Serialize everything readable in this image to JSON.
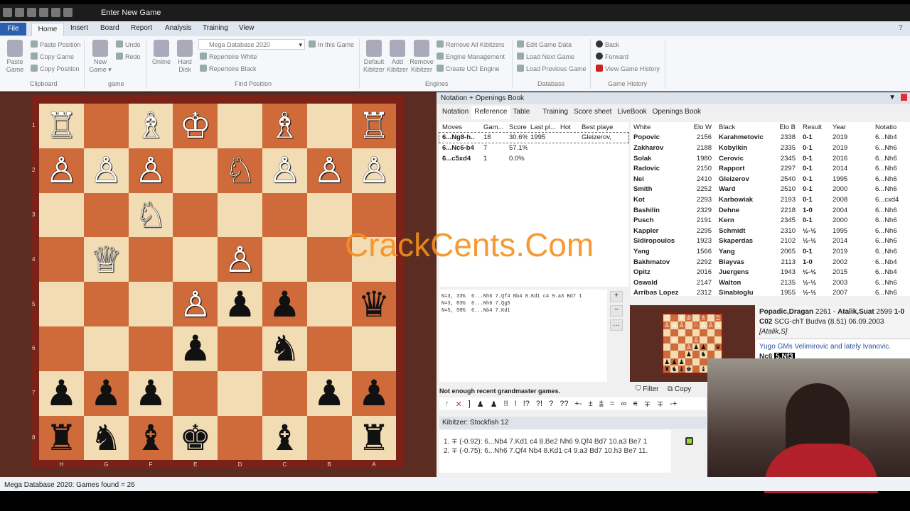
{
  "window": {
    "title": "Enter New Game"
  },
  "menu": {
    "file": "File",
    "tabs": [
      "Home",
      "Insert",
      "Board",
      "Report",
      "Analysis",
      "Training",
      "View"
    ]
  },
  "ribbon": {
    "clipboard": {
      "paste_game": "Paste Game",
      "paste_position": "Paste Position",
      "copy_game": "Copy Game",
      "copy_position": "Copy Position",
      "label": "Clipboard"
    },
    "game": {
      "new_game": "New Game",
      "undo": "Undo",
      "redo": "Redo",
      "label": "game"
    },
    "find": {
      "online": "Online",
      "hard_disk": "Hard Disk",
      "database": "Mega Database 2020",
      "in_this_game": "In this Game",
      "rep_white": "Repertoire White",
      "rep_black": "Repertoire Black",
      "label": "Find Position"
    },
    "engines": {
      "default": "Default Kibitzer",
      "add": "Add Kibitzer",
      "remove": "Remove Kibitzer",
      "remove_all": "Remove All Kibitzers",
      "management": "Engine Management",
      "create_uci": "Create UCI Engine",
      "label": "Engines"
    },
    "database": {
      "edit": "Edit Game Data",
      "next": "Load Next Game",
      "prev": "Load Previous Game",
      "label": "Database"
    },
    "history": {
      "back": "Back",
      "forward": "Forward",
      "view": "View Game History",
      "label": "Game History"
    }
  },
  "board": {
    "orientation": "black-bottom",
    "ranks": [
      "1",
      "2",
      "3",
      "4",
      "5",
      "6",
      "7",
      "8"
    ],
    "files": [
      "H",
      "G",
      "F",
      "E",
      "D",
      "C",
      "B",
      "A"
    ],
    "rows": [
      [
        "R",
        "",
        "B",
        "K",
        "",
        "B",
        "",
        "R"
      ],
      [
        "P",
        "P",
        "P",
        "",
        "N",
        "P",
        "P",
        "P"
      ],
      [
        "",
        "",
        "N",
        "",
        "",
        "",
        "",
        ""
      ],
      [
        "",
        "Q",
        "",
        "",
        "P",
        "",
        "",
        ""
      ],
      [
        "",
        "",
        "",
        "P",
        "p",
        "p",
        "",
        "q"
      ],
      [
        "",
        "",
        "",
        "p",
        "",
        "n",
        "",
        ""
      ],
      [
        "p",
        "p",
        "p",
        "",
        "",
        "",
        "p",
        "p"
      ],
      [
        "r",
        "n",
        "b",
        "k",
        "",
        "b",
        "",
        "r"
      ]
    ],
    "light": "#f2dcb4",
    "dark": "#cf6a3b"
  },
  "status": "Mega Database 2020: Games found = 26",
  "panel": {
    "title": "Notation + Openings Book",
    "tabs": [
      "Notation",
      "Reference",
      "Table",
      "Training",
      "Score sheet",
      "LiveBook",
      "Openings Book"
    ],
    "active_tab": "Reference"
  },
  "moves": {
    "headers": [
      "Moves",
      "Gam...",
      "Score",
      "Last pl...",
      "Hot",
      "Best playe"
    ],
    "rows": [
      [
        "6...Ng8-h..",
        "18",
        "30.6%",
        "1995",
        "",
        "Gleizerov,"
      ],
      [
        "6...Nc6-b4",
        "7",
        "57.1%",
        "",
        "",
        ""
      ],
      [
        "6...c5xd4",
        "1",
        "0.0%",
        "",
        "",
        ""
      ]
    ]
  },
  "games": {
    "headers": [
      "White",
      "Elo W",
      "Black",
      "Elo B",
      "Result",
      "Year",
      "Notatio"
    ],
    "rows": [
      [
        "Popovic",
        "2156",
        "Karahmetovic",
        "2338",
        "0-1",
        "2019",
        "6...Nb4"
      ],
      [
        "Zakharov",
        "2188",
        "Kobylkin",
        "2335",
        "0-1",
        "2019",
        "6...Nh6"
      ],
      [
        "Solak",
        "1980",
        "Cerovic",
        "2345",
        "0-1",
        "2016",
        "6...Nh6"
      ],
      [
        "Radovic",
        "2150",
        "Rapport",
        "2297",
        "0-1",
        "2014",
        "6...Nh6"
      ],
      [
        "Nei",
        "2410",
        "Gleizerov",
        "2540",
        "0-1",
        "1995",
        "6...Nh6"
      ],
      [
        "Smith",
        "2252",
        "Ward",
        "2510",
        "0-1",
        "2000",
        "6...Nh6"
      ],
      [
        "Kot",
        "2293",
        "Karbowiak",
        "2193",
        "0-1",
        "2008",
        "6...cxd4"
      ],
      [
        "Bashilin",
        "2329",
        "Dehne",
        "2218",
        "1-0",
        "2004",
        "6...Nh6"
      ],
      [
        "Pusch",
        "2191",
        "Kern",
        "2345",
        "0-1",
        "2000",
        "6...Nh6"
      ],
      [
        "Kappler",
        "2295",
        "Schmidt",
        "2310",
        "½-½",
        "1995",
        "6...Nh6"
      ],
      [
        "Sidiropoulos",
        "1923",
        "Skaperdas",
        "2102",
        "½-½",
        "2014",
        "6...Nh6"
      ],
      [
        "Yang",
        "1566",
        "Yang",
        "2065",
        "0-1",
        "2019",
        "6...Nh6"
      ],
      [
        "Bakhmatov",
        "2292",
        "Blayvas",
        "2113",
        "1-0",
        "2002",
        "6...Nb4"
      ],
      [
        "Opitz",
        "2016",
        "Juergens",
        "1943",
        "½-½",
        "2015",
        "6...Nb4"
      ],
      [
        "Oswald",
        "2147",
        "Walton",
        "2135",
        "½-½",
        "2003",
        "6...Nh6"
      ],
      [
        "Arribas Lopez",
        "2312",
        "Sinabioglu",
        "1955",
        "½-½",
        "2007",
        "6...Nh6"
      ]
    ]
  },
  "analysis": [
    "N=3, 33%  6...Nh6 7.Qf4 Nb4 8.Kd1 c4 9.a3 Bd7 1",
    "N=3, 83%  6...Nh6 7.Qg5",
    "N=5, 50%  6...Nb4 7.Kd1"
  ],
  "message": "Not enough recent grandmaster games.",
  "symbols": [
    "↑",
    "✕",
    "]",
    "♟",
    "♟",
    "!!",
    "!",
    "!?",
    "?!",
    "?",
    "??",
    "+-",
    "±",
    "⩲",
    "=",
    "∞",
    "⩳",
    "∓",
    "∓",
    "-+"
  ],
  "kibitzer": {
    "title": "Kibitzer: Stockfish 12",
    "lines": [
      "1. ∓ (-0.92): 6...Nb4 7.Kd1 c4 8.Be2 Nh6 9.Qf4 Bd7 10.a3 Be7 1",
      "2. ∓ (-0.75): 6...Nh6 7.Qf4 Nb4 8.Kd1 c4 9.a3 Bd7 10.h3 Be7 11."
    ]
  },
  "game_info": {
    "white": "Popadic,Dragan",
    "elo_w": "2261",
    "black": "Atalik,Suat",
    "elo_b": "2599",
    "result": "1-0",
    "eco": "C02",
    "event": "SCG-chT Budva (8.51) 06.09.2003",
    "annotator": "[Atalik,S]",
    "comment": "Yugo GMs Velimirovic and lately Ivanovic.",
    "move": "Nc6",
    "current": "5.Nf3"
  },
  "filter": "Filter",
  "copy": "Copy",
  "watermark": "CrackCents.Com"
}
